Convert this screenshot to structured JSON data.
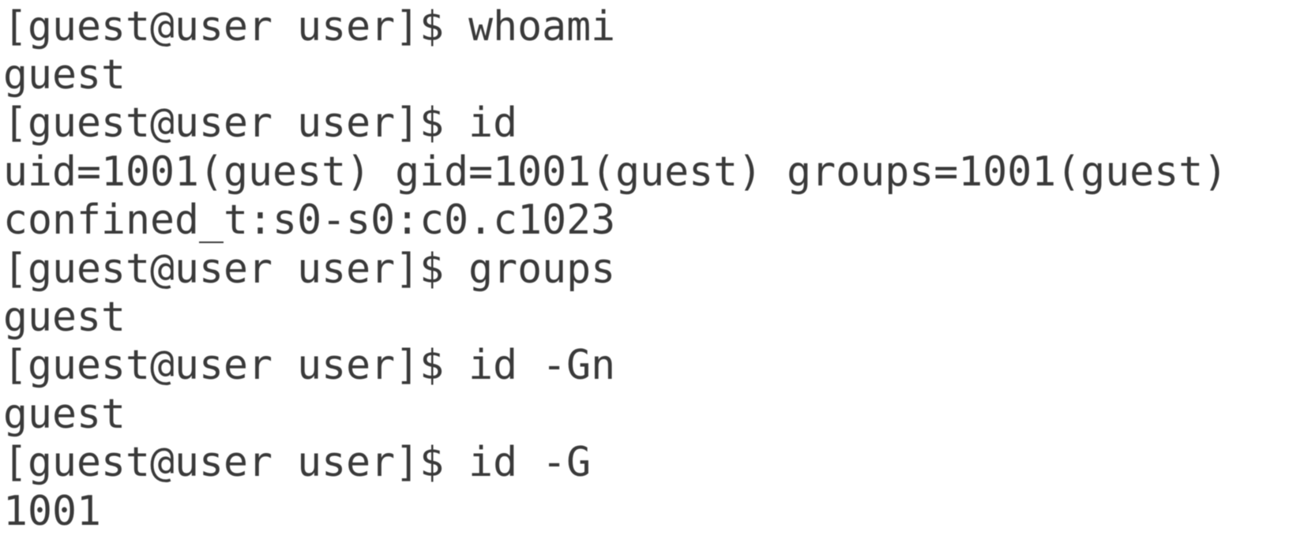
{
  "terminal": {
    "lines": [
      {
        "type": "command",
        "prompt": "[guest@user user]$ ",
        "command": "whoami"
      },
      {
        "type": "output",
        "text": "guest"
      },
      {
        "type": "command",
        "prompt": "[guest@user user]$ ",
        "command": "id"
      },
      {
        "type": "output",
        "text": "uid=1001(guest) gid=1001(guest) groups=1001(guest)"
      },
      {
        "type": "output",
        "text": "confined_t:s0-s0:c0.c1023"
      },
      {
        "type": "command",
        "prompt": "[guest@user user]$ ",
        "command": "groups"
      },
      {
        "type": "output",
        "text": "guest"
      },
      {
        "type": "command",
        "prompt": "[guest@user user]$ ",
        "command": "id -Gn"
      },
      {
        "type": "output",
        "text": "guest"
      },
      {
        "type": "command",
        "prompt": "[guest@user user]$ ",
        "command": "id -G"
      },
      {
        "type": "output",
        "text": "1001"
      }
    ]
  },
  "colors": {
    "background": "#ffffff",
    "text": "#3a3a3a"
  }
}
